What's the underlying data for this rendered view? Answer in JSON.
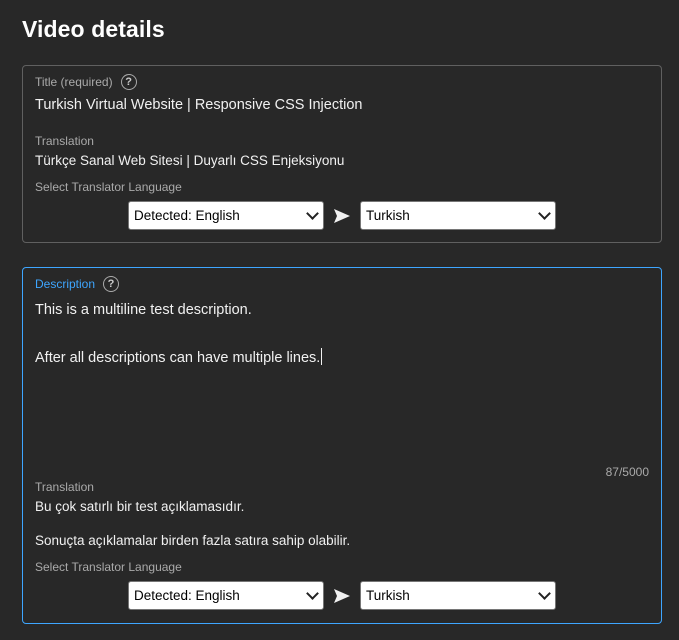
{
  "page": {
    "title": "Video details"
  },
  "title_field": {
    "label": "Title (required)",
    "value": "Turkish Virtual Website | Responsive CSS Injection",
    "translation_label": "Translation",
    "translation_value": "Türkçe Sanal Web Sitesi | Duyarlı CSS Enjeksiyonu",
    "select_language_label": "Select Translator Language",
    "source_language": "Detected: English",
    "target_language": "Turkish"
  },
  "description_field": {
    "label": "Description",
    "line1": "This is a multiline test description.",
    "line2": "After all descriptions can have multiple lines.",
    "counter": "87/5000",
    "translation_label": "Translation",
    "translation_line1": "Bu çok satırlı bir test açıklamasıdır.",
    "translation_line2": "Sonuçta açıklamalar birden fazla satıra sahip olabilir.",
    "select_language_label": "Select Translator Language",
    "source_language": "Detected: English",
    "target_language": "Turkish"
  },
  "icons": {
    "help": "help-icon",
    "arrow": "send-arrow-icon",
    "dropdown": "chevron-down-icon"
  },
  "colors": {
    "background": "#282828",
    "border": "#606060",
    "focus_accent": "#3ea6ff",
    "text_primary": "#f1f1f1",
    "text_secondary": "#aaaaaa"
  }
}
